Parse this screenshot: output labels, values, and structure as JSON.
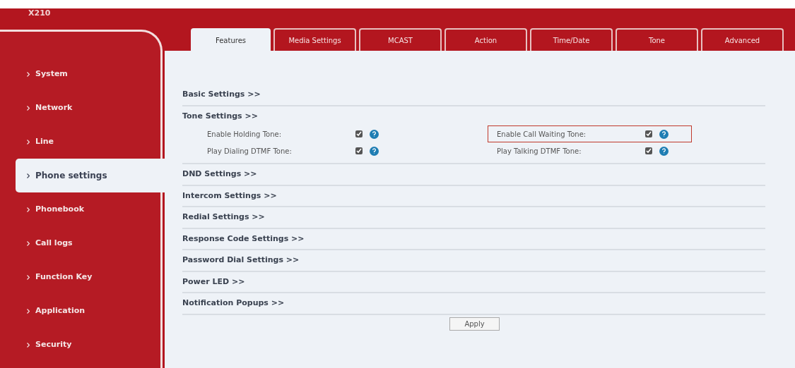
{
  "logo": "X210",
  "tabs": [
    {
      "label": "Features",
      "selected": true
    },
    {
      "label": "Media Settings",
      "selected": false
    },
    {
      "label": "MCAST",
      "selected": false
    },
    {
      "label": "Action",
      "selected": false
    },
    {
      "label": "Time/Date",
      "selected": false
    },
    {
      "label": "Tone",
      "selected": false
    },
    {
      "label": "Advanced",
      "selected": false
    }
  ],
  "sidebar": {
    "items": [
      {
        "label": "System",
        "selected": false
      },
      {
        "label": "Network",
        "selected": false
      },
      {
        "label": "Line",
        "selected": false
      },
      {
        "label": "Phone settings",
        "selected": true
      },
      {
        "label": "Phonebook",
        "selected": false
      },
      {
        "label": "Call logs",
        "selected": false
      },
      {
        "label": "Function Key",
        "selected": false
      },
      {
        "label": "Application",
        "selected": false
      },
      {
        "label": "Security",
        "selected": false
      }
    ]
  },
  "sections": [
    {
      "title": "Basic Settings >>"
    },
    {
      "title": "Tone Settings >>",
      "options": [
        {
          "label": "Enable Holding Tone:",
          "checked": true,
          "highlighted": false
        },
        {
          "label": "Enable Call Waiting Tone:",
          "checked": true,
          "highlighted": true
        },
        {
          "label": "Play Dialing DTMF Tone:",
          "checked": true,
          "highlighted": false
        },
        {
          "label": "Play Talking DTMF Tone:",
          "checked": true,
          "highlighted": false
        }
      ]
    },
    {
      "title": "DND Settings >>"
    },
    {
      "title": "Intercom Settings >>"
    },
    {
      "title": "Redial Settings >>"
    },
    {
      "title": "Response Code Settings >>"
    },
    {
      "title": "Password Dial Settings >>"
    },
    {
      "title": "Power LED >>"
    },
    {
      "title": "Notification Popups >>"
    }
  ],
  "apply_button": "Apply"
}
